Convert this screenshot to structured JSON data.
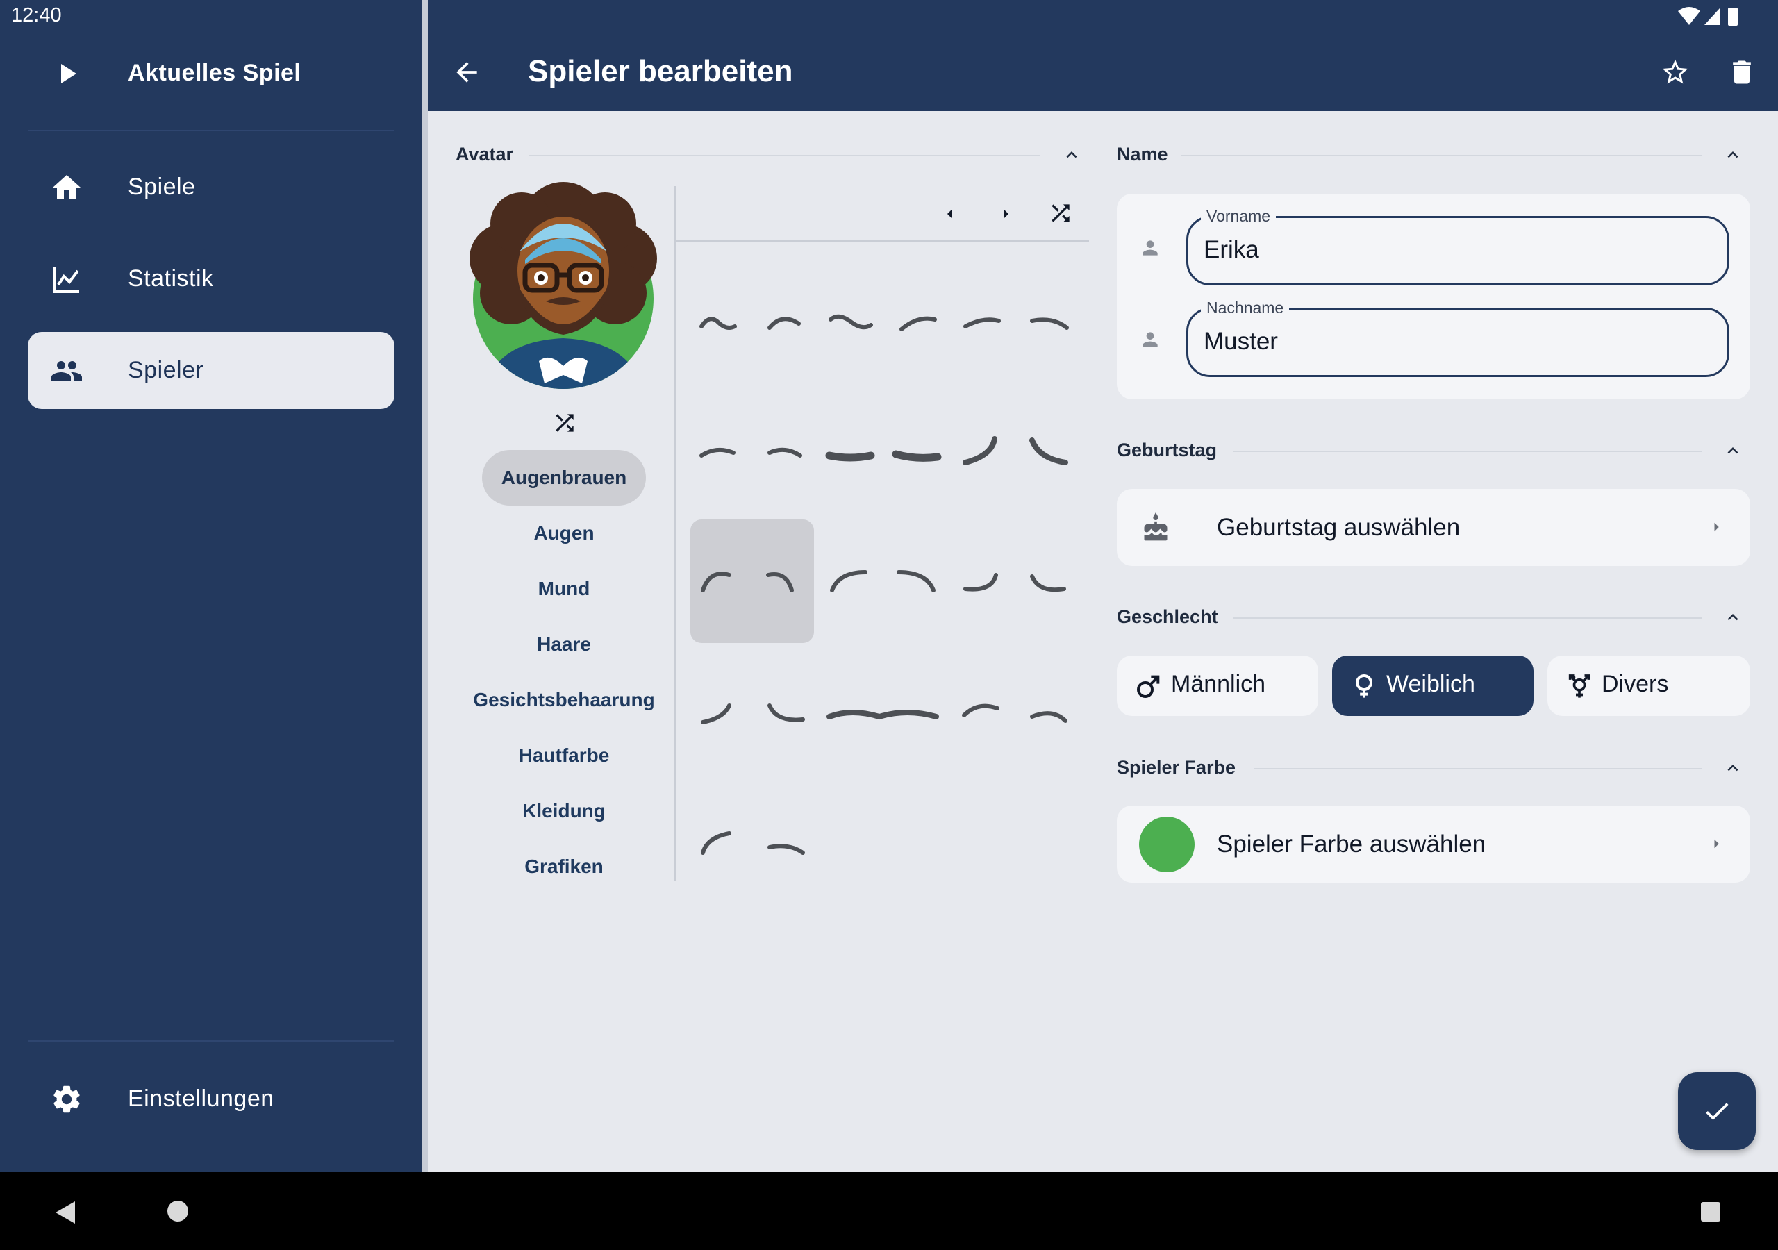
{
  "status_bar": {
    "time": "12:40"
  },
  "sidebar": {
    "current_game": {
      "label": "Aktuelles Spiel",
      "icon": "play-icon"
    },
    "items": [
      {
        "label": "Spiele",
        "icon": "home-icon"
      },
      {
        "label": "Statistik",
        "icon": "chart-icon"
      },
      {
        "label": "Spieler",
        "icon": "people-icon",
        "active": true
      }
    ],
    "settings": {
      "label": "Einstellungen",
      "icon": "gear-icon"
    }
  },
  "appbar": {
    "title": "Spieler bearbeiten",
    "back_icon": "arrow-left-icon",
    "favorite_icon": "star-outline-icon",
    "delete_icon": "trash-icon"
  },
  "avatar_section": {
    "title": "Avatar",
    "categories": [
      "Augenbrauen",
      "Augen",
      "Mund",
      "Haare",
      "Gesichtsbehaarung",
      "Hautfarbe",
      "Kleidung",
      "Grafiken"
    ],
    "selected_category": "Augenbrauen",
    "grid_rows": 5,
    "selected_item_row": 3,
    "selected_item_col": 1
  },
  "name_section": {
    "title": "Name",
    "first_name_label": "Vorname",
    "first_name_value": "Erika",
    "last_name_label": "Nachname",
    "last_name_value": "Muster"
  },
  "birthday_section": {
    "title": "Geburtstag",
    "button_label": "Geburtstag auswählen",
    "icon": "cake-icon"
  },
  "gender_section": {
    "title": "Geschlecht",
    "options": [
      {
        "label": "Männlich",
        "icon": "male-icon"
      },
      {
        "label": "Weiblich",
        "icon": "female-icon",
        "selected": true
      },
      {
        "label": "Divers",
        "icon": "transgender-icon"
      }
    ]
  },
  "color_section": {
    "title": "Spieler Farbe",
    "button_label": "Spieler Farbe auswählen",
    "swatch_color": "#4caf50"
  },
  "colors": {
    "primary": "#23395e",
    "surface": "#f4f5f8",
    "background": "#e7e9ee"
  },
  "fab": {
    "icon": "check-icon"
  }
}
